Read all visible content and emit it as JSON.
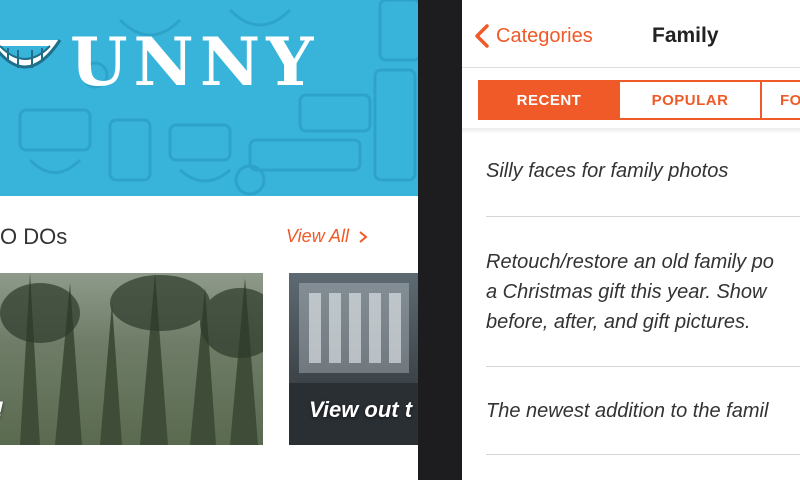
{
  "left_app": {
    "logo": {
      "text": "UNNY",
      "mark": "grin-smile-icon",
      "bg_color": "#38b3da"
    },
    "section": {
      "title": "O DOs",
      "view_all": "View All"
    },
    "cards": [
      {
        "caption": "!"
      },
      {
        "caption": "View out t"
      }
    ]
  },
  "right_app": {
    "nav": {
      "back_label": "Categories",
      "title": "Family"
    },
    "tabs": [
      {
        "label": "RECENT",
        "selected": true
      },
      {
        "label": "POPULAR",
        "selected": false
      },
      {
        "label": "FO",
        "selected": false
      }
    ],
    "items": [
      {
        "lines": [
          "Silly faces for family photos"
        ]
      },
      {
        "lines": [
          "Retouch/restore an old family po",
          "a Christmas gift this year. Show",
          "before, after, and gift pictures."
        ]
      },
      {
        "lines": [
          "The newest addition to the famil"
        ]
      }
    ]
  },
  "colors": {
    "accent": "#f05a28",
    "hero_blue": "#38b3da",
    "device_frame": "#1d1d1f"
  }
}
